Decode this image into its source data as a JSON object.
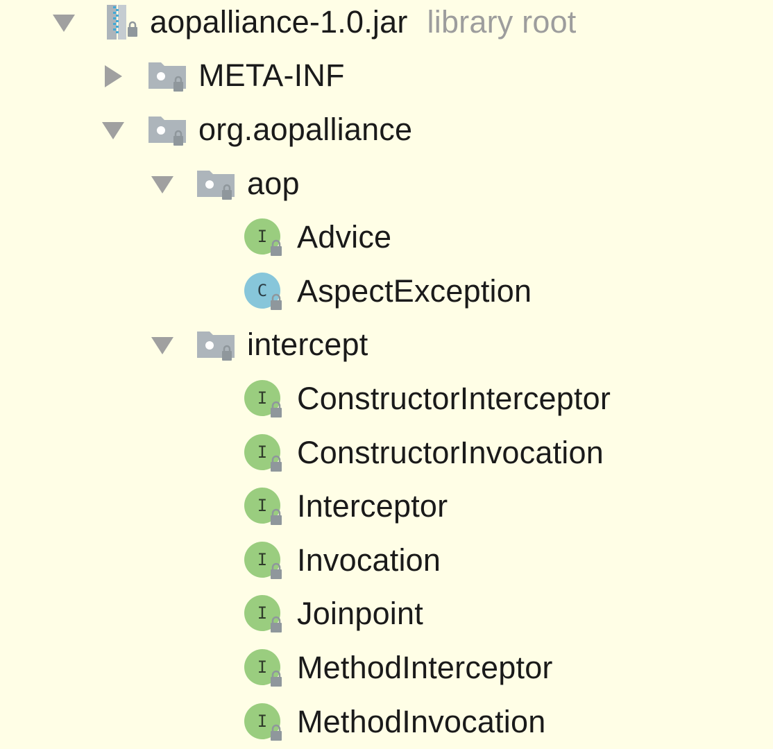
{
  "tree": {
    "root": {
      "label": "aopalliance-1.0.jar",
      "sublabel": "library root",
      "icon": "jar-archive-icon",
      "expanded": true
    },
    "meta_inf": {
      "label": "META-INF",
      "icon": "package-folder-locked-icon",
      "expanded": false
    },
    "org_aopalliance": {
      "label": "org.aopalliance",
      "icon": "package-folder-locked-icon",
      "expanded": true
    },
    "aop": {
      "label": "aop",
      "icon": "package-folder-locked-icon",
      "expanded": true,
      "children": [
        {
          "label": "Advice",
          "kind": "interface",
          "badge": "I"
        },
        {
          "label": "AspectException",
          "kind": "class",
          "badge": "C"
        }
      ]
    },
    "intercept": {
      "label": "intercept",
      "icon": "package-folder-locked-icon",
      "expanded": true,
      "children": [
        {
          "label": "ConstructorInterceptor",
          "kind": "interface",
          "badge": "I"
        },
        {
          "label": "ConstructorInvocation",
          "kind": "interface",
          "badge": "I"
        },
        {
          "label": "Interceptor",
          "kind": "interface",
          "badge": "I"
        },
        {
          "label": "Invocation",
          "kind": "interface",
          "badge": "I"
        },
        {
          "label": "Joinpoint",
          "kind": "interface",
          "badge": "I"
        },
        {
          "label": "MethodInterceptor",
          "kind": "interface",
          "badge": "I"
        },
        {
          "label": "MethodInvocation",
          "kind": "interface",
          "badge": "I"
        }
      ]
    }
  },
  "colors": {
    "background": "#fffee6",
    "interface_badge": "#9acd7f",
    "class_badge": "#87c6da",
    "folder": "#adb5bb",
    "lock": "#8f979c",
    "arrow": "#a0a0a0",
    "sublabel": "#9d9d9d"
  }
}
